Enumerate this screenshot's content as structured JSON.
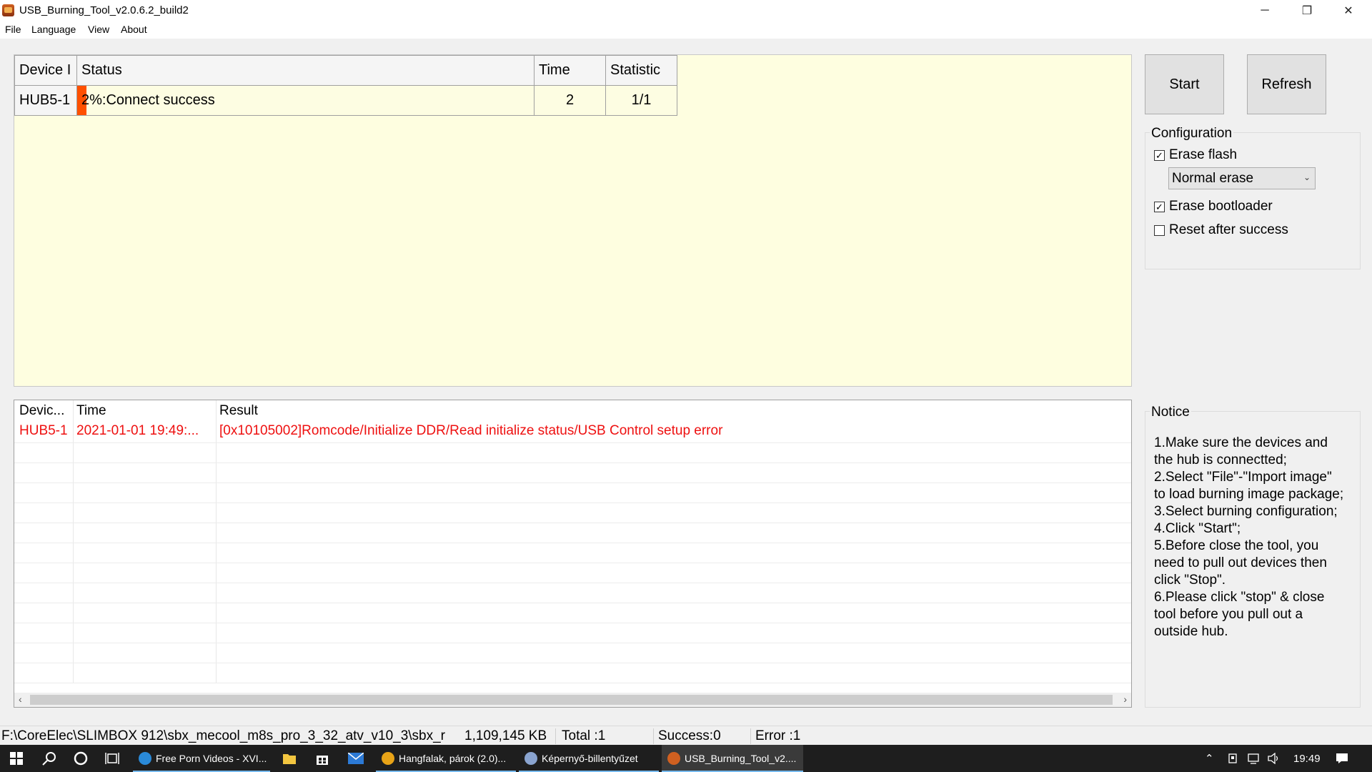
{
  "window": {
    "title": "USB_Burning_Tool_v2.0.6.2_build2",
    "minimize_icon": "─",
    "maximize_icon": "❐",
    "close_icon": "✕"
  },
  "menu": [
    "File",
    "Language",
    "View",
    "About"
  ],
  "device_table": {
    "headers": [
      "Device I",
      "Status",
      "Time",
      "Statistic"
    ],
    "row": {
      "device": "HUB5-1",
      "status": "2%:Connect success",
      "progress_percent": 2,
      "time": "2",
      "statistic": "1/1"
    }
  },
  "buttons": {
    "start": "Start",
    "refresh": "Refresh"
  },
  "configuration": {
    "title": "Configuration",
    "erase_flash": {
      "label": "Erase flash",
      "checked": true
    },
    "erase_mode": "Normal erase",
    "erase_bootloader": {
      "label": "Erase bootloader",
      "checked": true
    },
    "reset_after_success": {
      "label": "Reset after success",
      "checked": false
    }
  },
  "log": {
    "headers": [
      "Devic...",
      "Time",
      "Result"
    ],
    "rows": [
      {
        "device": "HUB5-1",
        "time": "2021-01-01 19:49:...",
        "result": "[0x10105002]Romcode/Initialize DDR/Read initialize status/USB Control setup error"
      }
    ],
    "error_color": "#ee1010"
  },
  "notice": {
    "title": "Notice",
    "lines": [
      "1.Make sure the devices and",
      "the hub is connectted;",
      "2.Select \"File\"-\"Import image\"",
      "to load burning image package;",
      "3.Select burning configuration;",
      "4.Click \"Start\";",
      "5.Before close the tool, you",
      "need to pull out devices then",
      "click \"Stop\".",
      "6.Please click \"stop\" & close",
      "tool before you pull out a",
      "outside hub."
    ]
  },
  "statusbar": {
    "path": "F:\\CoreElec\\SLIMBOX 912\\sbx_mecool_m8s_pro_3_32_atv_v10_3\\sbx_r",
    "size": "1,109,145 KB",
    "total": "Total :1",
    "success": "Success:0",
    "error": "Error :1"
  },
  "taskbar": {
    "apps": [
      {
        "label": "Free Porn Videos - XVI...",
        "icon": "edge-icon",
        "color": "#2a8ad8"
      },
      {
        "label": "Hangfalak, párok (2.0)...",
        "icon": "chrome-icon",
        "color": "#e8a317"
      },
      {
        "label": "Képernyő-billentyűzet",
        "icon": "keyboard-icon",
        "color": "#8aa4d0"
      },
      {
        "label": "USB_Burning_Tool_v2....",
        "icon": "usb-tool-icon",
        "color": "#d06020"
      }
    ],
    "clock": "19:49"
  }
}
